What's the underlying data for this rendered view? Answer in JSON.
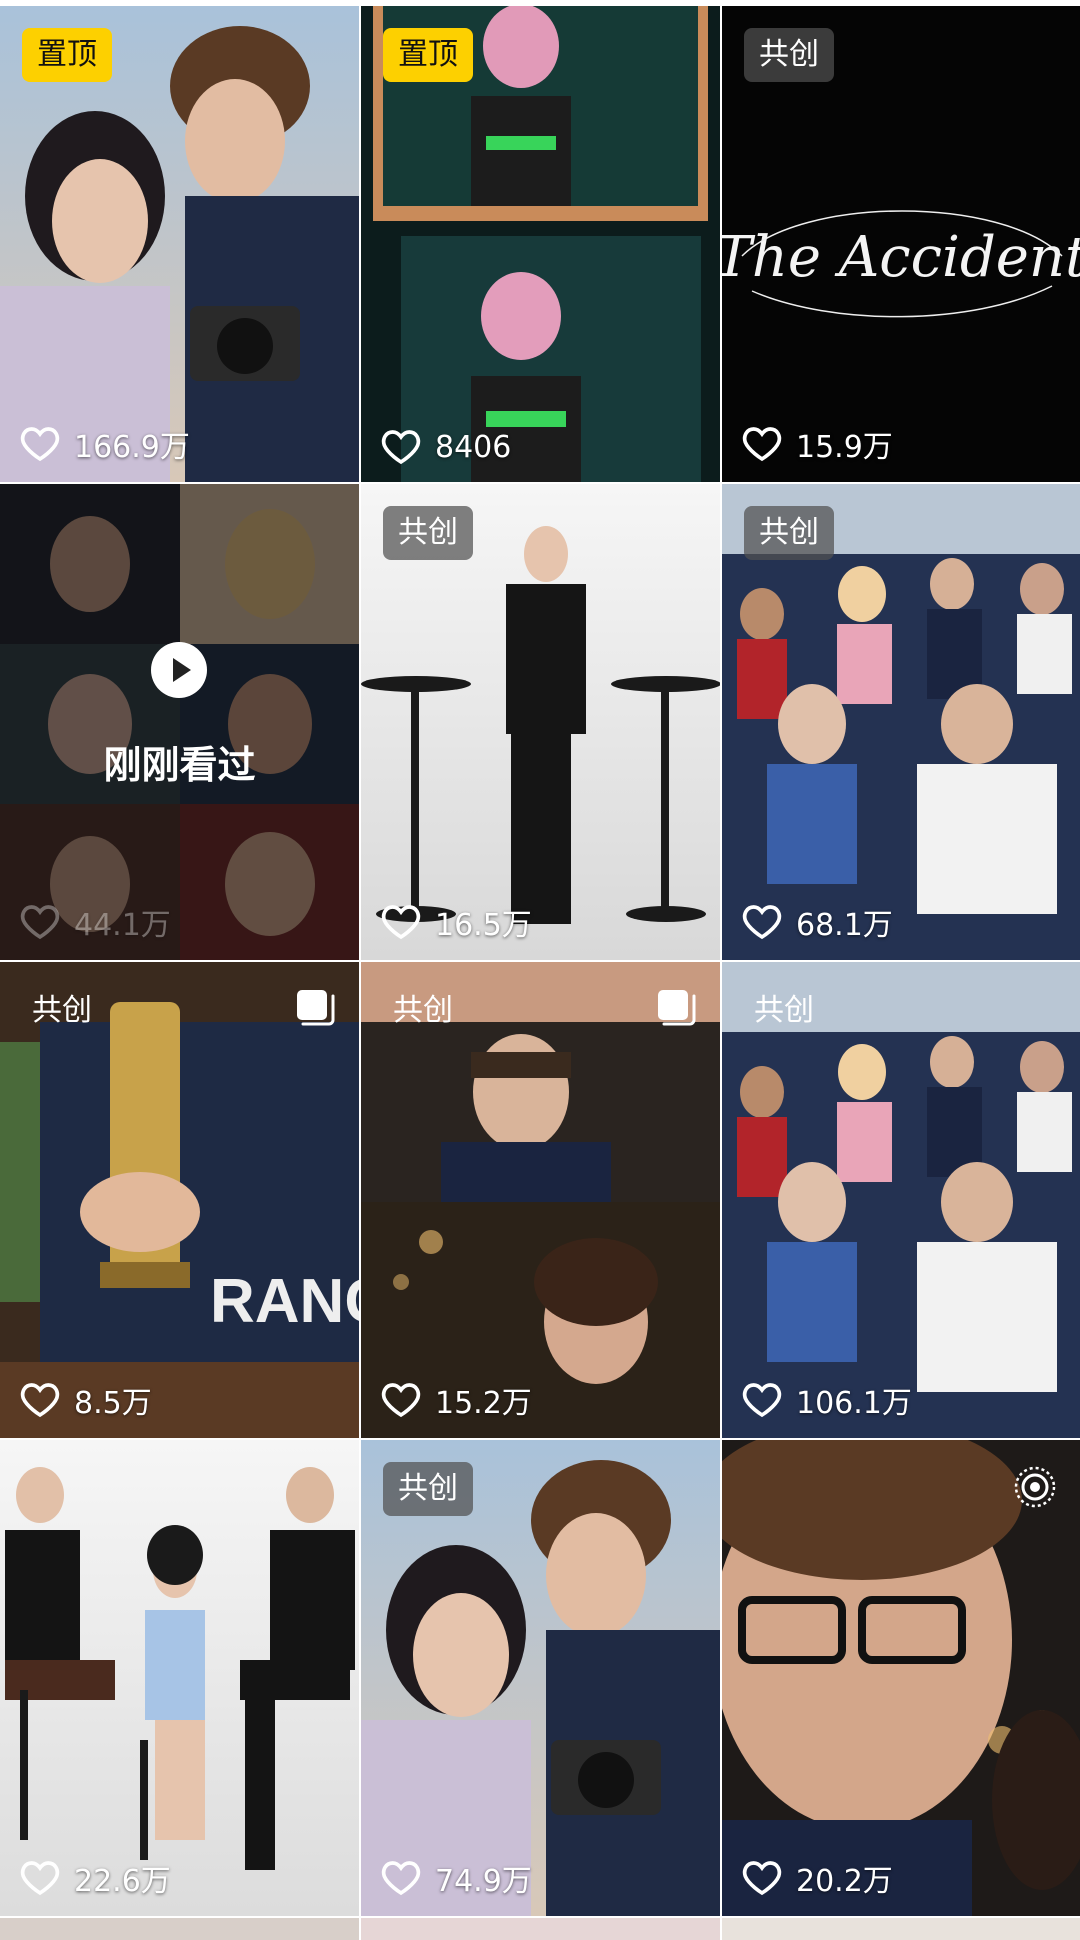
{
  "tiles": [
    {
      "badge": "置顶",
      "likes": "166.9万"
    },
    {
      "badge": "置顶",
      "likes": "8406"
    },
    {
      "badge": "共创",
      "likes": "15.9万",
      "overlay_title": "The Accident"
    },
    {
      "badge": "",
      "likes": "44.1万",
      "recent_label": "刚刚看过"
    },
    {
      "badge": "共创",
      "likes": "16.5万"
    },
    {
      "badge": "共创",
      "likes": "68.1万"
    },
    {
      "badge": "共创",
      "likes": "8.5万"
    },
    {
      "badge": "共创",
      "likes": "15.2万"
    },
    {
      "badge": "共创",
      "likes": "106.1万"
    },
    {
      "badge": "",
      "likes": "22.6万"
    },
    {
      "badge": "共创",
      "likes": "74.9万"
    },
    {
      "badge": "",
      "likes": "20.2万"
    }
  ],
  "colors": {
    "pinned_badge": "#fdd000",
    "badge_bg": "#505050"
  },
  "icons": {
    "like": "heart-outline-icon",
    "gallery": "multi-image-icon",
    "live": "live-icon",
    "play": "play-icon"
  }
}
